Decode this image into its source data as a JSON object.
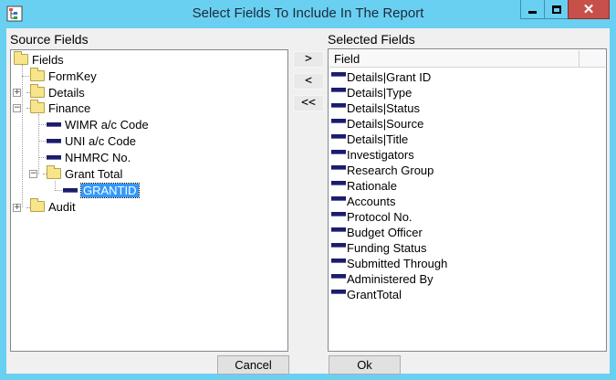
{
  "window": {
    "title": "Select Fields To Include In The Report",
    "icon": "app-tree-icon",
    "controls": [
      "minimize-icon",
      "maximize-icon",
      "close-icon"
    ],
    "close_glyph": "✕"
  },
  "source": {
    "label": "Source Fields",
    "tree": [
      {
        "label": "Fields",
        "type": "folder",
        "level": 0
      },
      {
        "label": "FormKey",
        "type": "folder",
        "level": 1
      },
      {
        "label": "Details",
        "type": "folder",
        "level": 1,
        "expander": "+"
      },
      {
        "label": "Finance",
        "type": "folder",
        "level": 1,
        "expander": "−"
      },
      {
        "label": "WIMR a/c Code",
        "type": "leaf",
        "level": 2
      },
      {
        "label": "UNI a/c Code",
        "type": "leaf",
        "level": 2
      },
      {
        "label": "NHMRC No.",
        "type": "leaf",
        "level": 2
      },
      {
        "label": "Grant Total",
        "type": "folder",
        "level": 2,
        "expander": "−"
      },
      {
        "label": "GRANTID",
        "type": "leaf",
        "level": 3,
        "selected": true
      },
      {
        "label": "Audit",
        "type": "folder",
        "level": 1,
        "expander": "+"
      }
    ]
  },
  "buttons": {
    "add": ">",
    "remove": "<",
    "remove_all": "<<",
    "cancel": "Cancel",
    "ok": "Ok"
  },
  "selected": {
    "label": "Selected Fields",
    "column_header": "Field",
    "items": [
      "Details|Grant ID",
      "Details|Type",
      "Details|Status",
      "Details|Source",
      "Details|Title",
      "Investigators",
      "Research Group",
      "Rationale",
      "Accounts",
      "Protocol No.",
      "Budget Officer",
      "Funding Status",
      "Submitted Through",
      "Administered By",
      "GrantTotal"
    ]
  }
}
